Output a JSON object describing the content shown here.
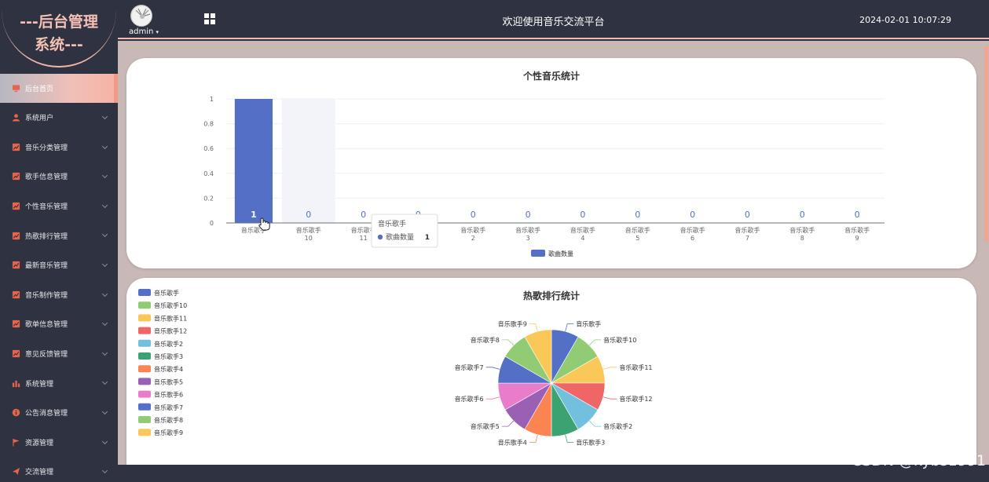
{
  "logo": {
    "line1": "---后台管理",
    "line2": "系统---"
  },
  "header": {
    "user": "admin",
    "title": "欢迎使用音乐交流平台",
    "datetime": "2024-02-01 10:07:29"
  },
  "sidebar": {
    "items": [
      {
        "label": "后台首页",
        "icon": "monitor-icon",
        "active": true
      },
      {
        "label": "系统用户",
        "icon": "user-icon"
      },
      {
        "label": "音乐分类管理",
        "icon": "chart-icon"
      },
      {
        "label": "歌手信息管理",
        "icon": "chart-icon"
      },
      {
        "label": "个性音乐管理",
        "icon": "chart-icon"
      },
      {
        "label": "热歌排行管理",
        "icon": "chart-icon"
      },
      {
        "label": "最新音乐管理",
        "icon": "chart-icon"
      },
      {
        "label": "音乐制作管理",
        "icon": "chart-icon"
      },
      {
        "label": "歌单信息管理",
        "icon": "chart-icon"
      },
      {
        "label": "意见反馈管理",
        "icon": "chart-icon"
      },
      {
        "label": "系统管理",
        "icon": "bar-chart-icon"
      },
      {
        "label": "公告消息管理",
        "icon": "info-icon"
      },
      {
        "label": "资源管理",
        "icon": "flag-icon"
      },
      {
        "label": "交流管理",
        "icon": "send-icon"
      }
    ]
  },
  "colors": {
    "accent": "#f4b8ac",
    "dark": "#2f3240",
    "bar": "#5470c6"
  },
  "chart_data": [
    {
      "type": "bar",
      "title": "个性音乐统计",
      "categories": [
        "音乐歌手",
        "音乐歌手10",
        "音乐歌手11",
        "音乐歌手12",
        "音乐歌手2",
        "音乐歌手3",
        "音乐歌手4",
        "音乐歌手5",
        "音乐歌手6",
        "音乐歌手7",
        "音乐歌手8",
        "音乐歌手9"
      ],
      "series": [
        {
          "name": "歌曲数量",
          "values": [
            1,
            0,
            0,
            0,
            0,
            0,
            0,
            0,
            0,
            0,
            0,
            0
          ]
        }
      ],
      "ylim": [
        0,
        1
      ],
      "yticks": [
        "0",
        "0.2",
        "0.4",
        "0.6",
        "0.8",
        "1"
      ],
      "legend": "bottom-center",
      "tooltip": {
        "title": "音乐歌手",
        "series": "歌曲数量",
        "value": "1"
      }
    },
    {
      "type": "pie",
      "title": "热歌排行统计",
      "labels": [
        "音乐歌手",
        "音乐歌手10",
        "音乐歌手11",
        "音乐歌手12",
        "音乐歌手2",
        "音乐歌手3",
        "音乐歌手4",
        "音乐歌手5",
        "音乐歌手6",
        "音乐歌手7",
        "音乐歌手8",
        "音乐歌手9"
      ],
      "values": [
        1,
        1,
        1,
        1,
        1,
        1,
        1,
        1,
        1,
        1,
        1,
        1
      ],
      "colors": [
        "#5470c6",
        "#91cc75",
        "#fac858",
        "#ee6666",
        "#73c0de",
        "#3ba272",
        "#fc8452",
        "#9a60b4",
        "#ea7ccc",
        "#5470c6",
        "#91cc75",
        "#fac858"
      ],
      "legend": "top-left"
    }
  ],
  "watermark": "CSDN @kybs1991"
}
